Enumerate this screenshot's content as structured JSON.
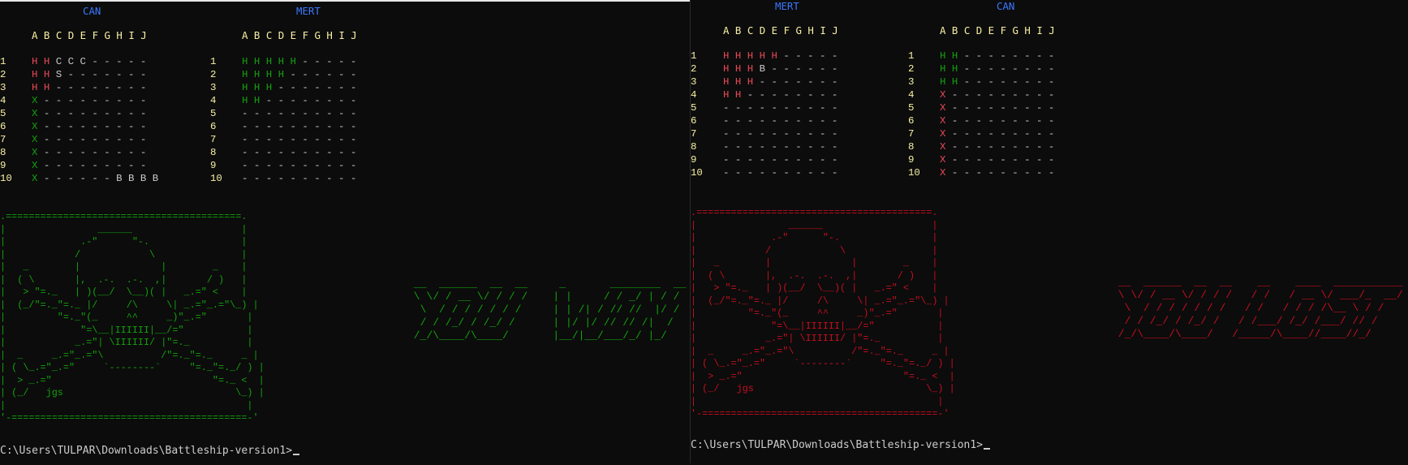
{
  "left": {
    "player_label": "CAN",
    "opponent_label": "MERT",
    "col_header": "A B C D E F G H I J",
    "row_numbers": [
      "1",
      "2",
      "3",
      "4",
      "5",
      "6",
      "7",
      "8",
      "9",
      "10"
    ],
    "player_grid": [
      "H H C C C - - - - -",
      "H H S - - - - - - -",
      "H H - - - - - - - -",
      "X - - - - - - - - -",
      "X - - - - - - - - -",
      "X - - - - - - - - -",
      "X - - - - - - - - -",
      "X - - - - - - - - -",
      "X - - - - - - - - -",
      "X - - - - - - B B B B"
    ],
    "opponent_grid": [
      "H H H H H - - - - -",
      "H H H H - - - - - -",
      "H H H - - - - - - -",
      "H H - - - - - - - -",
      "- - - - - - - - - -",
      "- - - - - - - - - -",
      "- - - - - - - - - -",
      "- - - - - - - - - -",
      "- - - - - - - - - -",
      "- - - - - - - - - -"
    ],
    "skull_art": ".=========================================.\n|                ______                   |\n|             .-\"      \"-.                |\n|            /            \\               |\n|   _        |              |        _    |\n|  ( \\       |,  .-.  .-.  ,|       / )   |\n|   > \"=._   | )(__/  \\__)( |   _.=\" <    |\n|  (_/\"=._\"=._ |/     /\\     \\| _.=\"_.=\"\\_) |\n|         \"=._\"(_     ^^     _)\"_.=\"       |\n|             \"=\\__|IIIIII|__/=\"           |\n|            _.=\"| \\IIIIII/ |\"=._          |\n|  _     _.=\"_.=\"\\          /\"=._\"=._     _ |\n| ( \\_.=\"_.=\"     `--------`     \"=._\"=._/ ) |\n|  > _.=\"                            \"=._ <  |\n| (_/   jgs                              \\_) |\n|                                          |\n'-=========================================-'",
    "banner_art": " __  ______  __  __     _       ________  __\n \\ \\/ / __ \\/ / / /    | |     / / _/ | / /\n  \\  / / / / / / /     | | /| / // //  |/ / \n  / / /_/ / /_/ /      | |/ |/ // // /|  /  \n /_/\\____/\\____/       |__/|__/___/_/ |_/   ",
    "prompt": "C:\\Users\\TULPAR\\Downloads\\Battleship-version1>"
  },
  "right": {
    "player_label": "MERT",
    "opponent_label": "CAN",
    "col_header": "A B C D E F G H I J",
    "row_numbers": [
      "1",
      "2",
      "3",
      "4",
      "5",
      "6",
      "7",
      "8",
      "9",
      "10"
    ],
    "player_grid": [
      "H H H H H - - - - -",
      "H H H B - - - - - -",
      "H H H - - - - - - -",
      "H H - - - - - - - -",
      "- - - - - - - - - -",
      "- - - - - - - - - -",
      "- - - - - - - - - -",
      "- - - - - - - - - -",
      "- - - - - - - - - -",
      "- - - - - - - - - -"
    ],
    "opponent_grid": [
      "H H - - - - - - - -",
      "H H - - - - - - - -",
      "H H - - - - - - - -",
      "X - - - - - - - - -",
      "X - - - - - - - - -",
      "X - - - - - - - - -",
      "X - - - - - - - - -",
      "X - - - - - - - - -",
      "X - - - - - - - - -",
      "X - - - - - - - - -"
    ],
    "skull_art": ".=========================================.\n|                ______                   |\n|             .-\"      \"-.                |\n|            /            \\               |\n|   _        |              |        _    |\n|  ( \\       |,  .-.  .-.  ,|       / )   |\n|   > \"=._   | )(__/  \\__)( |   _.=\" <    |\n|  (_/\"=._\"=._ |/     /\\     \\| _.=\"_.=\"\\_) |\n|         \"=._\"(_     ^^     _)\"_.=\"       |\n|             \"=\\__|IIIIII|__/=\"           |\n|            _.=\"| \\IIIIII/ |\"=._          |\n|  _     _.=\"_.=\"\\          /\"=._\"=._     _ |\n| ( \\_.=\"_.=\"     `--------`     \"=._\"=._/ ) |\n|  > _.=\"                            \"=._ <  |\n| (_/   jgs                              \\_) |\n|                                          |\n'-=========================================-'",
    "banner_art": " __  ______  __  __    __    ____  ___________\n \\ \\/ / __ \\/ / / /   / /   / __ \\/ ___/_  __/\n  \\  / / / / / / /   / /   / / / /\\__ \\ / /   \n  / / /_/ / /_/ /   / /___/ /_/ /___/ // /    \n /_/\\____/\\____/   /_____/\\____//____//_/     ",
    "prompt": "C:\\Users\\TULPAR\\Downloads\\Battleship-version1>"
  },
  "colors": {
    "background": "#0c0c0c",
    "player_name": "#3b78ff",
    "axis": "#f9f1a5",
    "hit_player": "#e74856",
    "hit_opponent": "#13a10e",
    "win_art": "#13a10e",
    "lose_art": "#c50f1f"
  }
}
